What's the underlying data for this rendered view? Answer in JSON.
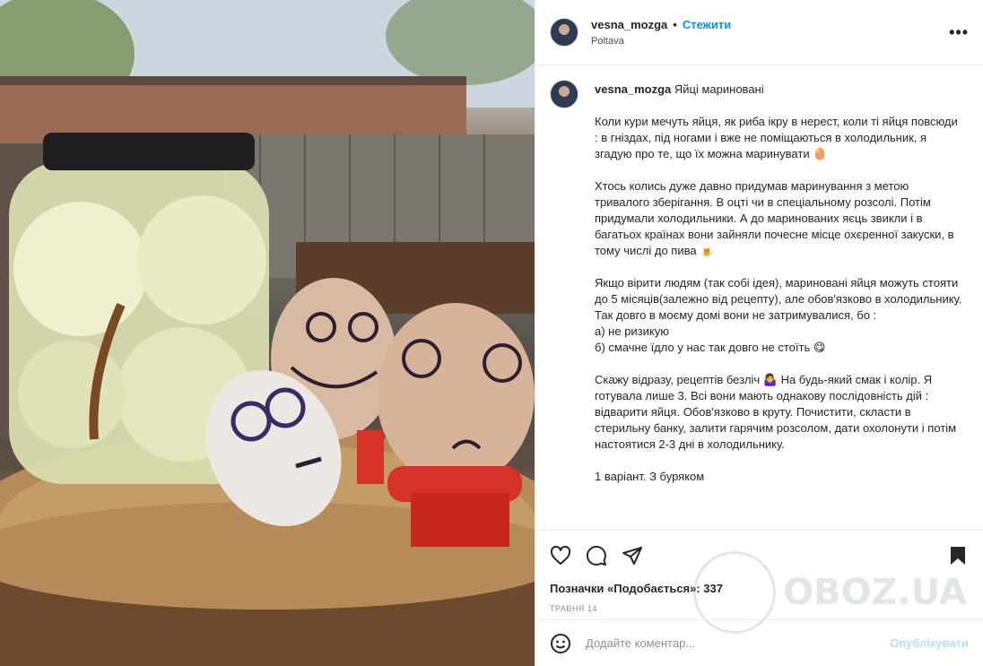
{
  "post": {
    "username": "vesna_mozga",
    "follow_label": "Стежити",
    "location": "Poltava",
    "more_label": "•••"
  },
  "caption": {
    "username": "vesna_mozga",
    "title": "Яйці мариновані",
    "paragraphs": [
      "Коли кури мечуть яйця, як риба ікру в нерест, коли ті яйця повсюди : в гніздах, під ногами і вже не поміщаються в холодильник, я згадую про те, що їх можна маринувати 🥚",
      "Хтось колись дуже давно придумав маринування з метою тривалого зберігання. В оцті чи в спеціальному розсолі. Потім придумали холодильники. А до маринованих яєць звикли і в багатьох країнах вони зайняли почесне місце охєренної закуски, в тому числі до пива 🍺",
      "Якщо вірити людям (так собі ідея), мариновані яйця можуть стояти до 5 місяців(залежно від рецепту), але обов'язково в холодильнику. Так довго в моєму домі вони не затримувалися, бо :\nа) не ризикую\nб) смачне їдло у нас так довго не стоїть 😋",
      "Скажу відразу, рецептів безліч 🤷‍♀️ На будь-який смак і колір. Я готувала лише 3. Всі вони мають однакову послідовність дій : відварити яйця. Обов'язково в круту. Почистити, скласти в стерильну банку, залити гарячим розсолом, дати охолонути і потім настоятися 2-3 дні в холодильнику.",
      "1 варіант. З буряком"
    ]
  },
  "stats": {
    "likes_label": "Позначки «Подобається»: 337",
    "date": "травня 14"
  },
  "comment": {
    "placeholder": "Додайте коментар...",
    "publish_label": "Опублікувати"
  },
  "watermark": {
    "text": "OBOZ.UA"
  },
  "colors": {
    "accent": "#0095f6",
    "publish_disabled": "#b2dffc",
    "border": "#efefef",
    "muted": "#8e8e8e"
  }
}
